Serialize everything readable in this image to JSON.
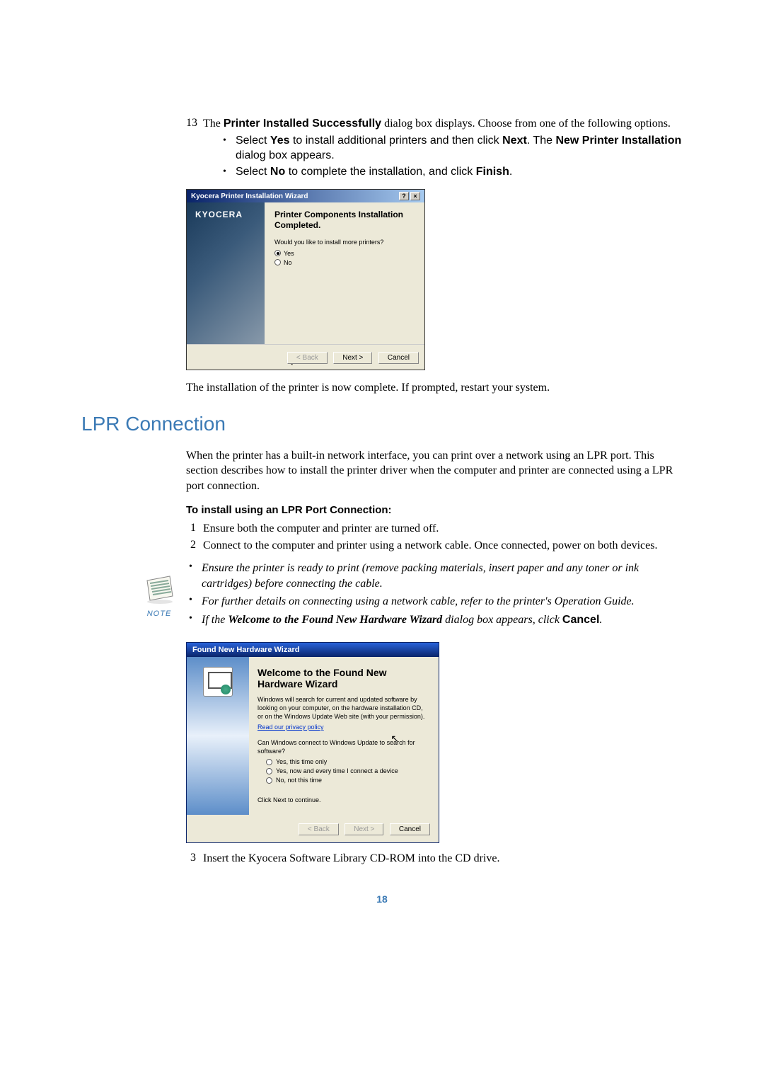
{
  "step13": {
    "num": "13",
    "line1_a": "The ",
    "line1_bold": "Printer Installed Successfully",
    "line1_b": " dialog box displays. Choose from one of the following options.",
    "bullet1_a": "Select ",
    "bullet1_yes": "Yes",
    "bullet1_b": " to install additional printers and then click ",
    "bullet1_next": "Next",
    "bullet1_c": ". The ",
    "bullet1_new": "New Printer Installation",
    "bullet1_d": " dialog box appears.",
    "bullet2_a": "Select ",
    "bullet2_no": "No",
    "bullet2_b": " to complete the installation, and click ",
    "bullet2_fin": "Finish",
    "bullet2_c": "."
  },
  "dialog1": {
    "title": "Kyocera Printer Installation Wizard",
    "logo": "KYOCERA",
    "heading": "Printer Components Installation Completed.",
    "question": "Would you like to install more printers?",
    "opt_yes": "Yes",
    "opt_no": "No",
    "btn_back": "< Back",
    "btn_next": "Next >",
    "btn_cancel": "Cancel"
  },
  "after_dialog1": "The installation of the printer is now complete. If prompted, restart your system.",
  "section_title": "LPR Connection",
  "lpr_intro": "When the printer has a built-in network interface, you can print over a network using an LPR port. This section describes how to install the printer driver when the computer and printer are connected using a LPR port connection.",
  "subhead": "To install using an LPR Port Connection:",
  "step1": {
    "num": "1",
    "text": "Ensure both the computer and printer are turned off."
  },
  "step2": {
    "num": "2",
    "text": "Connect to the computer and printer using a network cable. Once connected, power on both devices."
  },
  "note": {
    "label": "NOTE",
    "b1": "Ensure the printer is ready to print (remove packing materials, insert paper and any toner or ink cartridges) before connecting the cable.",
    "b2": "For further details on connecting using a network cable, refer to the printer's Operation Guide.",
    "b3_a": "If the ",
    "b3_bold": "Welcome to the Found New Hardware Wizard",
    "b3_b": " dialog box appears, click ",
    "b3_cancel": "Cancel",
    "b3_c": "."
  },
  "dialog2": {
    "title": "Found New Hardware Wizard",
    "heading": "Welcome to the Found New Hardware Wizard",
    "para": "Windows will search for current and updated software by looking on your computer, on the hardware installation CD, or on the Windows Update Web site (with your permission).",
    "link": "Read our privacy policy",
    "question": "Can Windows connect to Windows Update to search for software?",
    "opt1": "Yes, this time only",
    "opt2": "Yes, now and every time I connect a device",
    "opt3": "No, not this time",
    "continue": "Click Next to continue.",
    "btn_back": "< Back",
    "btn_next": "Next >",
    "btn_cancel": "Cancel"
  },
  "step3": {
    "num": "3",
    "text": "Insert the Kyocera Software Library CD-ROM into the CD drive."
  },
  "page_number": "18"
}
